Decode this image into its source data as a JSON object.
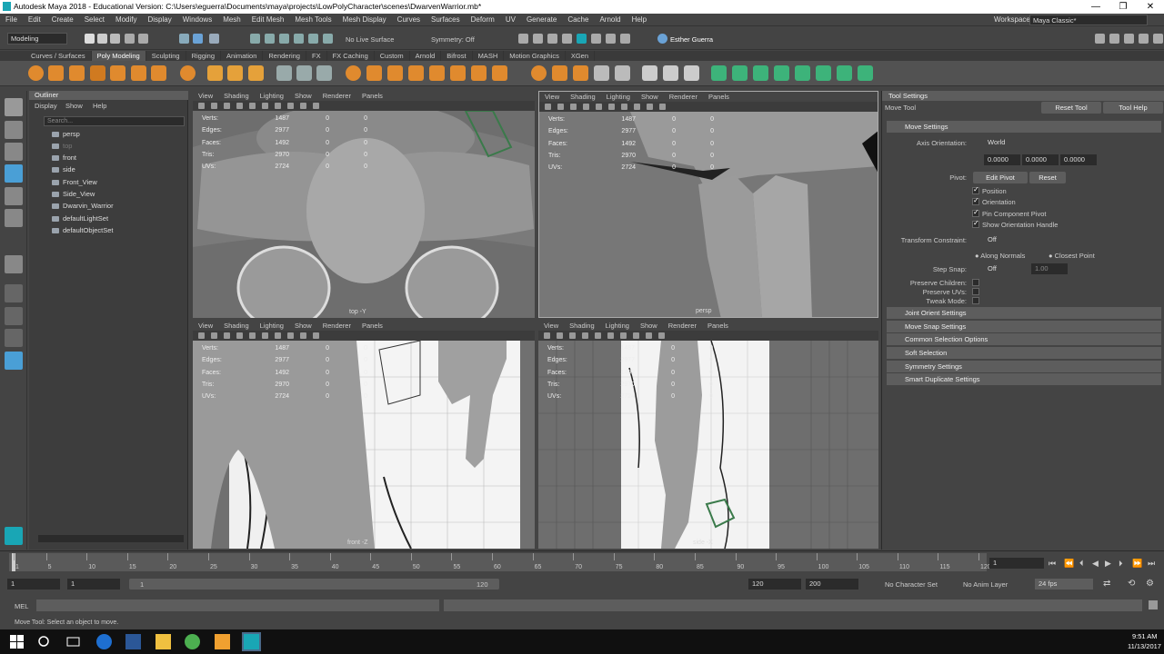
{
  "window": {
    "title": "Autodesk Maya 2018 - Educational Version: C:\\Users\\eguerra\\Documents\\maya\\projects\\LowPolyCharacter\\scenes\\DwarvenWarrior.mb*",
    "minimize": "—",
    "maximize": "❐",
    "close": "✕"
  },
  "menu": [
    "File",
    "Edit",
    "Create",
    "Select",
    "Modify",
    "Display",
    "Windows",
    "Mesh",
    "Edit Mesh",
    "Mesh Tools",
    "Mesh Display",
    "Curves",
    "Surfaces",
    "Deform",
    "UV",
    "Generate",
    "Cache",
    "Arnold",
    "Help"
  ],
  "workspace": {
    "label": "Workspace :",
    "value": "Maya Classic*"
  },
  "status": {
    "mode": "Modeling",
    "live_surface": "No Live Surface",
    "symmetry": "Symmetry: Off",
    "user": "Esther Guerra"
  },
  "shelf_tabs": [
    "Curves / Surfaces",
    "Poly Modeling",
    "Sculpting",
    "Rigging",
    "Animation",
    "Rendering",
    "FX",
    "FX Caching",
    "Custom",
    "Arnold",
    "Bifrost",
    "MASH",
    "Motion Graphics",
    "XGen"
  ],
  "shelf_active": "Poly Modeling",
  "outliner": {
    "title": "Outliner",
    "menu": [
      "Display",
      "Show",
      "Help"
    ],
    "search_placeholder": "Search...",
    "items": [
      "persp",
      "top",
      "front",
      "side",
      "Front_View",
      "Side_View",
      "Dwarvin_Warrior",
      "defaultLightSet",
      "defaultObjectSet"
    ]
  },
  "viewport_menu": [
    "View",
    "Shading",
    "Lighting",
    "Show",
    "Renderer",
    "Panels"
  ],
  "hud": {
    "rows": [
      [
        "Verts:",
        "1487",
        "0",
        "0"
      ],
      [
        "Edges:",
        "2977",
        "0",
        "0"
      ],
      [
        "Faces:",
        "1492",
        "0",
        "0"
      ],
      [
        "Tris:",
        "2970",
        "0",
        "0"
      ],
      [
        "UVs:",
        "2724",
        "0",
        "0"
      ]
    ]
  },
  "cameras": {
    "tl": "top -Y",
    "tr": "persp",
    "bl": "front -Z",
    "br": "side -X"
  },
  "tool_settings": {
    "title": "Tool Settings",
    "tool": "Move Tool",
    "reset": "Reset Tool",
    "help": "Tool Help",
    "section": "Move Settings",
    "axis_label": "Axis Orientation:",
    "axis_value": "World",
    "xyz": [
      "0.0000",
      "0.0000",
      "0.0000"
    ],
    "pivot_label": "Pivot:",
    "edit_pivot": "Edit Pivot",
    "pivot_reset": "Reset",
    "checks": [
      "Position",
      "Orientation",
      "Pin Component Pivot",
      "Show Orientation Handle"
    ],
    "constraint_label": "Transform Constraint:",
    "constraint_value": "Off",
    "along_normals": "Along Normals",
    "closest_point": "Closest Point",
    "step_label": "Step Snap:",
    "step_value": "Off",
    "step_num": "1.00",
    "preserve": [
      "Preserve Children:",
      "Preserve UVs:",
      "Tweak Mode:"
    ],
    "sections": [
      "Joint Orient Settings",
      "Move Snap Settings",
      "Common Selection Options",
      "Soft Selection",
      "Symmetry Settings",
      "Smart Duplicate Settings"
    ]
  },
  "timeline": {
    "ticks": [
      "1",
      "5",
      "10",
      "15",
      "20",
      "25",
      "30",
      "35",
      "40",
      "45",
      "50",
      "55",
      "60",
      "65",
      "70",
      "75",
      "80",
      "85",
      "90",
      "95",
      "100",
      "105",
      "110",
      "115",
      "120"
    ],
    "current": "1"
  },
  "range": {
    "start": "1",
    "start2": "1",
    "slider_start": "1",
    "slider_end": "120",
    "end": "120",
    "end2": "200",
    "char_set": "No Character Set",
    "anim_layer": "No Anim Layer",
    "fps": "24 fps"
  },
  "cmd": {
    "label": "MEL"
  },
  "help_line": "Move Tool: Select an object to move.",
  "clock": {
    "time": "9:51 AM",
    "date": "11/13/2017"
  }
}
